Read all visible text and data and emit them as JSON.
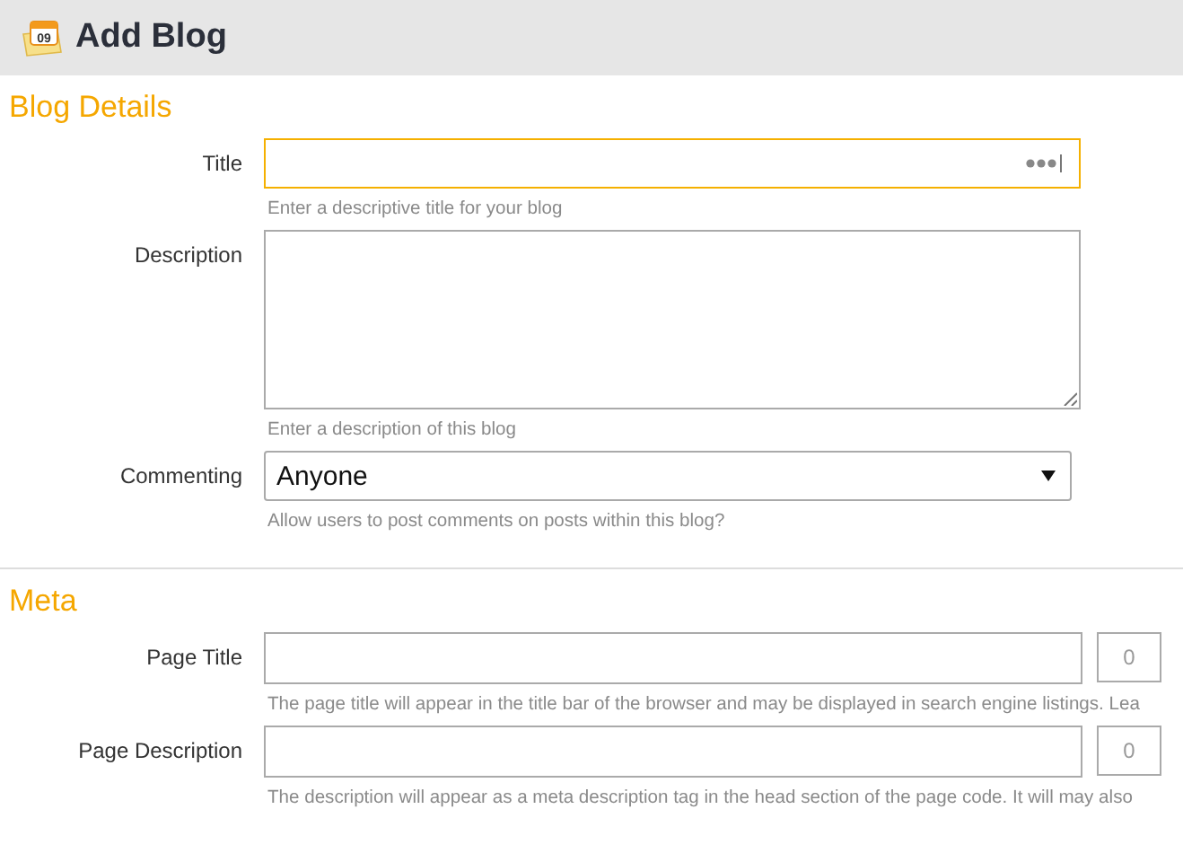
{
  "header": {
    "icon_text": "09",
    "title": "Add Blog"
  },
  "sections": [
    {
      "title": "Blog Details",
      "fields": [
        {
          "kind": "text",
          "label": "Title",
          "focused": true,
          "hint": "Enter a descriptive title for your blog"
        },
        {
          "kind": "textarea",
          "label": "Description",
          "focused": false,
          "hint": "Enter a description of this blog"
        },
        {
          "kind": "select",
          "label": "Commenting",
          "value": "Anyone",
          "focused": false,
          "hint": "Allow users to post comments on posts within this blog?"
        }
      ]
    },
    {
      "title": "Meta",
      "fields": [
        {
          "kind": "counted",
          "label": "Page Title",
          "count": "0",
          "focused": false,
          "hint": "The page title will appear in the title bar of the browser and may be displayed in search engine listings. Lea"
        },
        {
          "kind": "counted",
          "label": "Page Description",
          "count": "0",
          "focused": false,
          "hint": "The description will appear as a meta description tag in the head section of the page code. It will may also"
        }
      ]
    }
  ]
}
